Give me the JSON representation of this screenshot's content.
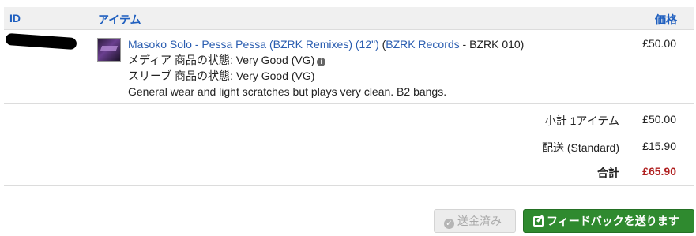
{
  "table": {
    "headers": {
      "id": "ID",
      "item": "アイテム",
      "price": "価格"
    },
    "items": [
      {
        "title": "Masoko Solo - Pessa Pessa (BZRK Remixes) (12\")",
        "label_open": " (",
        "label": "BZRK Records",
        "catalog": " - BZRK 010)",
        "media_condition": "メディア 商品の状態: Very Good (VG)",
        "sleeve_condition": "スリーブ 商品の状態: Very Good (VG)",
        "comment": "General wear and light scratches but plays very clean. B2 bangs.",
        "price": "£50.00",
        "info_icon": "i"
      }
    ]
  },
  "totals": {
    "subtotal_label": "小計 1アイテム",
    "subtotal_value": "£50.00",
    "shipping_label": "配送 (Standard)",
    "shipping_value": "£15.90",
    "total_label": "合計",
    "total_value": "£65.90",
    "total_color": "#b02020"
  },
  "actions": {
    "sent_label": "送金済み",
    "feedback_label": "フィードバックを送ります",
    "check_glyph": "✓"
  },
  "colors": {
    "link": "#2a5db0",
    "header_text": "#1f5fbf",
    "feedback_button": "#2f8a2f"
  }
}
